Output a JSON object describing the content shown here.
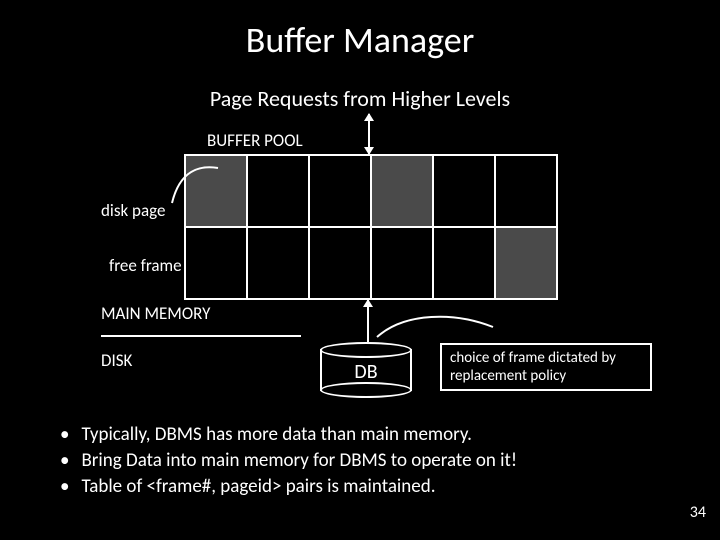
{
  "title": "Buffer Manager",
  "subtitle": "Page Requests from Higher Levels",
  "labels": {
    "buffer_pool": "BUFFER POOL",
    "disk_page": "disk page",
    "free_frame": "free frame",
    "main_memory": "MAIN MEMORY",
    "disk": "DISK",
    "db": "DB"
  },
  "policy_box": "choice of frame dictated by replacement policy",
  "grid": {
    "rows": 2,
    "cols": 6,
    "filled_cells": [
      [
        0,
        0
      ],
      [
        0,
        3
      ],
      [
        1,
        5
      ]
    ]
  },
  "bullets": [
    "Typically, DBMS has more data than main memory.",
    "Bring Data into main memory for DBMS to operate on it!",
    "Table of <frame#, pageid> pairs is maintained."
  ],
  "page_number": "34"
}
